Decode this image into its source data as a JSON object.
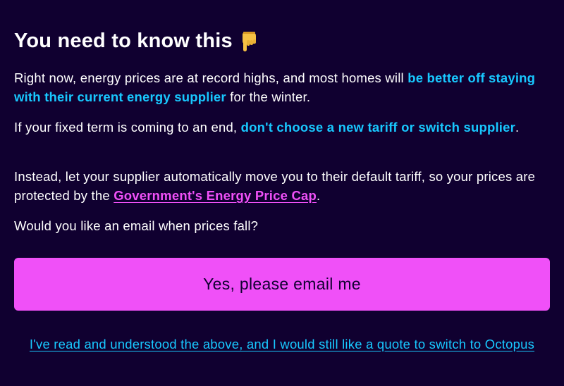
{
  "heading": {
    "title": "You need to know this",
    "icon": "hand-pointing-down-icon"
  },
  "paragraph1": {
    "text_before": "Right now, energy prices are at record highs, and most homes will ",
    "highlight": "be better off staying with their current energy supplier",
    "text_after": " for the winter."
  },
  "paragraph2": {
    "text_before": "If your fixed term is coming to an end, ",
    "highlight": "don't choose a new tariff or switch supplier",
    "text_after": "."
  },
  "paragraph3": {
    "text_before": "Instead, let your supplier automatically move you to their default tariff, so your prices are protected by the ",
    "link": "Government's Energy Price Cap",
    "text_after": "."
  },
  "paragraph4": {
    "text": "Would you like an email when prices fall?"
  },
  "cta": {
    "label": "Yes, please email me"
  },
  "switch_link": {
    "label": "I've read and understood the above, and I would still like a quote to switch to Octopus"
  },
  "colors": {
    "background": "#100030",
    "highlight": "#18c8ff",
    "accent": "#f050f8"
  }
}
